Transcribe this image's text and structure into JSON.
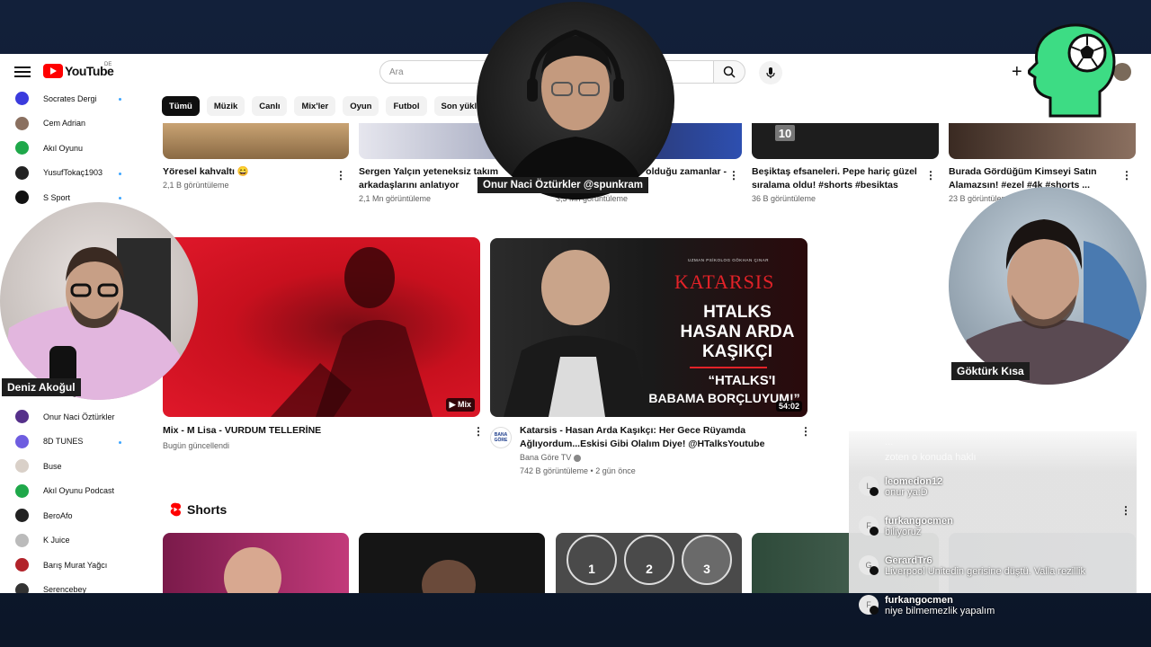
{
  "masthead": {
    "logo_text": "YouTube",
    "country_code": "DE",
    "search_placeholder": "Ara",
    "create_label": "+"
  },
  "chips": [
    "Tümü",
    "Müzik",
    "Canlı",
    "Mix'ler",
    "Oyun",
    "Futbol",
    "Son yüklen"
  ],
  "sidebar": {
    "items": [
      {
        "label": "Socrates Dergi",
        "color": "#3b3bdd",
        "dot": true
      },
      {
        "label": "Cem Adrian",
        "color": "#8a7060",
        "dot": false
      },
      {
        "label": "Akıl Oyunu",
        "color": "#1fa84a",
        "dot": false
      },
      {
        "label": "YusufTokaç1903",
        "color": "#222222",
        "dot": true
      },
      {
        "label": "S Sport",
        "color": "#111111",
        "dot": true
      }
    ],
    "items_lower": [
      {
        "label": "Onur Naci Öztürkler",
        "color": "#55308a",
        "dot": false
      },
      {
        "label": "8D TUNES",
        "color": "#6e5de0",
        "dot": true
      },
      {
        "label": "Buse",
        "color": "#d9d0c8",
        "dot": false
      },
      {
        "label": "Akıl Oyunu Podcast",
        "color": "#1fa84a",
        "dot": false
      },
      {
        "label": "BeroAfo",
        "color": "#222222",
        "dot": false
      },
      {
        "label": "K Juice",
        "color": "#bbbbbb",
        "dot": false
      },
      {
        "label": "Barış Murat Yağcı",
        "color": "#b2232a",
        "dot": false
      },
      {
        "label": "Serencebey",
        "color": "#333333",
        "dot": false
      }
    ]
  },
  "row1": [
    {
      "title": "Yöresel kahvaltı 😄",
      "meta": "2,1 B görüntüleme"
    },
    {
      "title": "Sergen Yalçın yeteneksiz takım arkadaşlarını anlatıyor",
      "meta": "2,1 Mn görüntüleme"
    },
    {
      "title": "olduğu zamanlar -",
      "meta": "3,3 Mn görüntüleme"
    },
    {
      "title": "Beşiktaş efsaneleri. Pepe hariç güzel sıralama oldu! #shorts #besiktas",
      "meta": "36 B görüntüleme",
      "badge": "10"
    },
    {
      "title": "Burada Gördüğüm Kimseyi Satın Alamazsın! #ezel #4k #shorts ...",
      "meta": "23 B görüntüleme"
    }
  ],
  "row2": [
    {
      "title": "Mix - M Lisa - VURDUM TELLERİNE",
      "meta": "Bugün güncellendi",
      "badge": "Mix"
    },
    {
      "title": "Katarsis - Hasan Arda Kaşıkçı: Her Gece Rüyamda Ağlıyordum...Eskisi Gibi Olalım Diye! @HTalksYoutube",
      "channel": "Bana Göre TV",
      "meta": "742 B görüntüleme • 2 gün önce",
      "duration": "54:02",
      "channel_badge": "BANA GÖRE"
    }
  ],
  "katarsis_thumb": {
    "kicker": "UZMAN PSİKOLOG GÖKHAN ÇINAR",
    "brand": "KATARSIS",
    "line1": "HTALKS",
    "line2": "HASAN ARDA",
    "line3": "KAŞIKÇI",
    "quote1": "“HTALKS'I",
    "quote2": "BABAMA BORÇLUYUM!”"
  },
  "shorts": {
    "heading": "Shorts",
    "numbers": [
      "1",
      "2",
      "3"
    ]
  },
  "overlays": {
    "center_name": "Onur Naci Öztürkler @spunkram",
    "left_name": "Deniz Akoğul",
    "right_name": "Göktürk Kısa"
  },
  "chat": {
    "faded_line1": "...",
    "faded_line2": "zoten o konuda haklı",
    "messages": [
      {
        "user": "leomedon12",
        "text": "onur ya:D",
        "initial": "L"
      },
      {
        "user": "furkangocmen",
        "text": "biliyoruz",
        "initial": "F"
      },
      {
        "user": "GerardTr6",
        "text": "Liverpool Unitedin gerisine düştü. Valla rezillik",
        "initial": "G"
      },
      {
        "user": "furkangocmen",
        "text": "niye bilmemezlik yapalım",
        "initial": "F"
      }
    ]
  },
  "colors": {
    "brand_red": "#ff0000",
    "head_logo_green": "#3ddc84"
  }
}
